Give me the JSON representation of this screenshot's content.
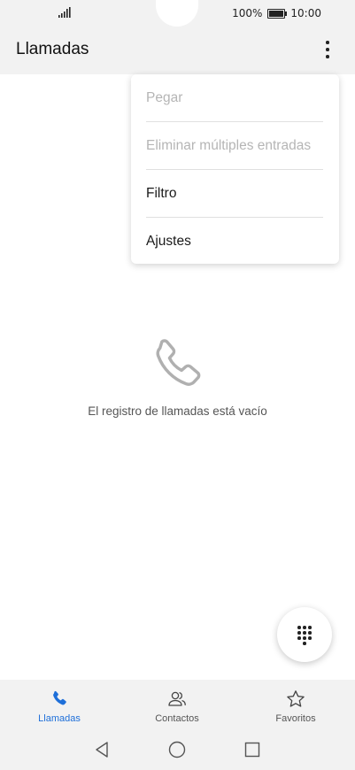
{
  "status_bar": {
    "battery_percent": "100%",
    "time": "10:00"
  },
  "app_bar": {
    "title": "Llamadas"
  },
  "menu": {
    "items": [
      {
        "label": "Pegar",
        "enabled": false
      },
      {
        "label": "Eliminar múltiples entradas",
        "enabled": false
      },
      {
        "label": "Filtro",
        "enabled": true
      },
      {
        "label": "Ajustes",
        "enabled": true
      }
    ]
  },
  "empty_state": {
    "message": "El registro de llamadas está vacío"
  },
  "bottom_nav": {
    "tabs": [
      {
        "label": "Llamadas",
        "icon": "phone-icon",
        "active": true
      },
      {
        "label": "Contactos",
        "icon": "contacts-icon",
        "active": false
      },
      {
        "label": "Favoritos",
        "icon": "star-icon",
        "active": false
      }
    ]
  },
  "colors": {
    "accent": "#1e6fd9",
    "bar_background": "#f2f2f2"
  }
}
